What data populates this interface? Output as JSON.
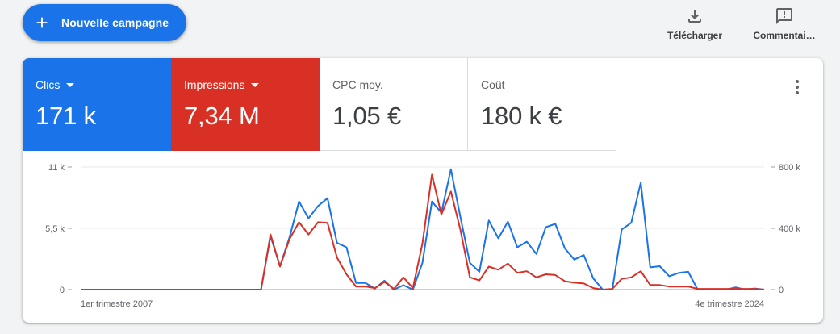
{
  "header": {
    "new_campaign_label": "Nouvelle campagne",
    "download_label": "Télécharger",
    "comment_label": "Commentai…"
  },
  "metrics": [
    {
      "label": "Clics",
      "value": "171 k",
      "selected": true,
      "color": "#1a73e8"
    },
    {
      "label": "Impressions",
      "value": "7,34 M",
      "selected": true,
      "color": "#d93025"
    },
    {
      "label": "CPC moy.",
      "value": "1,05 €",
      "selected": false
    },
    {
      "label": "Coût",
      "value": "180 k €",
      "selected": false
    }
  ],
  "icons": {
    "new_campaign": "plus-icon",
    "download": "download-icon",
    "comment": "feedback-icon",
    "more": "more-vert-icon"
  },
  "chart_data": {
    "type": "line",
    "y_left_ticks": [
      "11 k",
      "5,5 k",
      "0"
    ],
    "y_right_ticks": [
      "800 k",
      "400 k",
      "0"
    ],
    "ylim_left": [
      0,
      11000
    ],
    "ylim_right": [
      0,
      800000
    ],
    "x_start_label": "1er trimestre 2007",
    "x_end_label": "4e trimestre 2024",
    "series": [
      {
        "name": "Clics",
        "color": "#1a73e8",
        "axis": "left",
        "values": [
          0,
          0,
          0,
          0,
          0,
          0,
          0,
          0,
          0,
          0,
          0,
          0,
          0,
          0,
          0,
          0,
          0,
          0,
          0,
          0,
          4800,
          2100,
          4700,
          7900,
          6400,
          7500,
          8200,
          4200,
          3800,
          600,
          600,
          100,
          800,
          0,
          400,
          0,
          2400,
          7900,
          6900,
          10800,
          6500,
          2400,
          1600,
          6200,
          4600,
          6100,
          3800,
          4300,
          3200,
          5600,
          5900,
          3700,
          2700,
          3100,
          1000,
          0,
          0,
          5400,
          6000,
          9600,
          2000,
          2100,
          1200,
          1500,
          1600,
          0,
          0,
          0,
          0,
          200,
          0,
          100,
          0
        ],
        "note_x": "quarters from 2007-Q1 to 2024-Q4"
      },
      {
        "name": "Impressions",
        "color": "#d93025",
        "axis": "right",
        "values": [
          0,
          0,
          0,
          0,
          0,
          0,
          0,
          0,
          0,
          0,
          0,
          0,
          0,
          0,
          0,
          0,
          0,
          0,
          0,
          0,
          360000,
          150000,
          330000,
          440000,
          360000,
          440000,
          435000,
          210000,
          100000,
          20000,
          20000,
          10000,
          50000,
          5000,
          80000,
          10000,
          300000,
          750000,
          490000,
          640000,
          390000,
          80000,
          60000,
          150000,
          130000,
          170000,
          110000,
          120000,
          80000,
          100000,
          95000,
          55000,
          45000,
          40000,
          10000,
          0,
          5000,
          70000,
          80000,
          120000,
          30000,
          30000,
          20000,
          20000,
          20000,
          5000,
          5000,
          5000,
          5000,
          5000,
          5000,
          5000,
          0
        ]
      }
    ]
  }
}
